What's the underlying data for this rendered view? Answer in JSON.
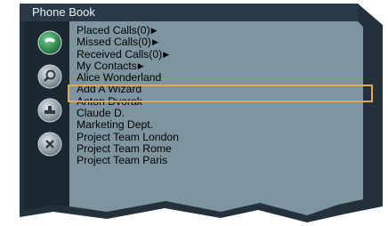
{
  "window": {
    "title": "Phone Book"
  },
  "icons": [
    {
      "name": "phone-call-icon",
      "color": "#2e8a52"
    },
    {
      "name": "magnifier-icon",
      "color": "#8e9aa3"
    },
    {
      "name": "tray-icon",
      "color": "#8e9aa3"
    },
    {
      "name": "delete-icon",
      "color": "#8e9aa3"
    }
  ],
  "menu": {
    "items": [
      {
        "label": "Placed Calls(0)",
        "submenu": true
      },
      {
        "label": "Missed Calls(0)",
        "submenu": true
      },
      {
        "label": "Received Calls(0)",
        "submenu": true
      },
      {
        "label": "My Contacts",
        "submenu": true
      }
    ],
    "arrow": "▶"
  },
  "contacts": [
    {
      "label": "Alice Wonderland",
      "selected": true
    },
    {
      "label": "Add A Wizard"
    },
    {
      "label": "Anton Dvorak"
    },
    {
      "label": "Claude D."
    },
    {
      "label": "Marketing Dept."
    },
    {
      "label": "Project Team London"
    },
    {
      "label": "Project Team Rome"
    },
    {
      "label": "Project Team Paris"
    }
  ],
  "colors": {
    "frame": "#23313d",
    "panel": "#7e959f",
    "icon_column": "#1b2731",
    "selection": "#e7a84d",
    "title_text": "#eef2f4"
  }
}
